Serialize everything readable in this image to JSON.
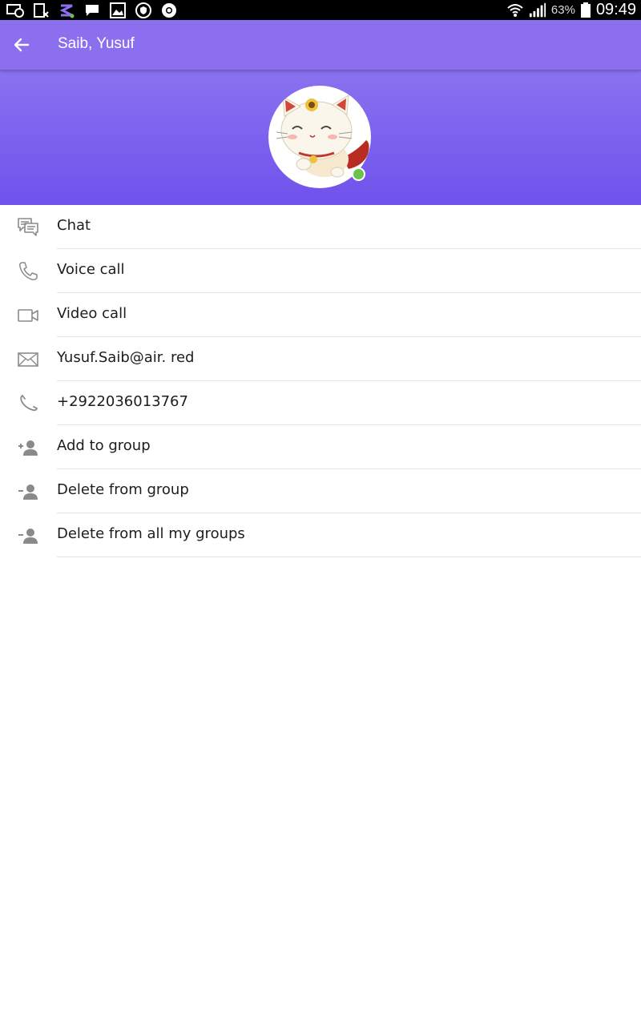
{
  "status_bar": {
    "battery_percent": "63%",
    "time": "09:49"
  },
  "toolbar": {
    "title": "Saib, Yusuf"
  },
  "profile": {
    "online": true,
    "online_color": "#6cc24a"
  },
  "actions": [
    {
      "label": "Chat",
      "icon": "chat-icon"
    },
    {
      "label": "Voice call",
      "icon": "phone-icon"
    },
    {
      "label": "Video call",
      "icon": "video-camera-icon"
    },
    {
      "label": "Yusuf.Saib@air. red",
      "icon": "envelope-icon"
    },
    {
      "label": "+2922036013767",
      "icon": "phone-handset-icon"
    },
    {
      "label": "Add to group",
      "icon": "add-person-icon"
    },
    {
      "label": "Delete from group",
      "icon": "remove-person-icon"
    },
    {
      "label": "Delete from all my groups",
      "icon": "remove-person-icon"
    }
  ],
  "colors": {
    "accent": "#8c6fef",
    "header_gradient_end": "#6f52ec"
  }
}
